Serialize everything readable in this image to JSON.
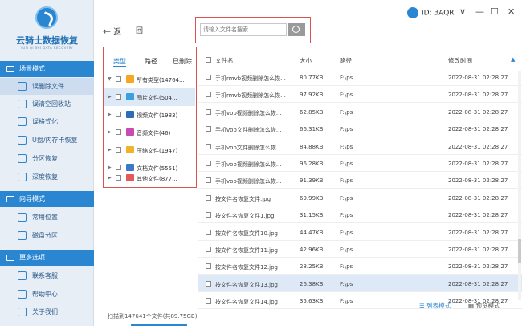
{
  "app": {
    "name": "云骑士数据恢复",
    "name_sub": "YUN QI SHI DATA RECOVERY",
    "user_label": "ID: 3AQR",
    "window_controls": [
      "∨",
      "—",
      "☐",
      "✕"
    ]
  },
  "sidebar": {
    "sections": [
      {
        "title": "场景模式",
        "items": [
          {
            "label": "误删除文件",
            "icon": "delete-file-icon",
            "active": true
          },
          {
            "label": "误清空回收站",
            "icon": "recycle-bin-icon"
          },
          {
            "label": "误格式化",
            "icon": "format-icon"
          },
          {
            "label": "U盘/内存卡恢复",
            "icon": "usb-icon"
          },
          {
            "label": "分区恢复",
            "icon": "partition-icon"
          },
          {
            "label": "深度恢复",
            "icon": "deep-scan-icon"
          }
        ]
      },
      {
        "title": "向导模式",
        "items": [
          {
            "label": "常用位置",
            "icon": "location-icon"
          },
          {
            "label": "磁盘分区",
            "icon": "disk-icon"
          }
        ]
      },
      {
        "title": "更多选项",
        "items": [
          {
            "label": "联系客服",
            "icon": "support-icon"
          },
          {
            "label": "帮助中心",
            "icon": "help-icon"
          },
          {
            "label": "关于我们",
            "icon": "info-icon"
          }
        ]
      }
    ]
  },
  "toolbar": {
    "back_label": "返",
    "back_arrow": "←",
    "home_label": "回",
    "search_placeholder": "请输入文件名搜索"
  },
  "tree": {
    "tabs": [
      "类型",
      "路径",
      "已删除"
    ],
    "rows": [
      {
        "label": "所有类型(14764...",
        "color": "#f5a623",
        "expand": "▼",
        "selected": false
      },
      {
        "label": "图片文件(504...",
        "color": "#3aa0e0",
        "expand": "▶",
        "selected": true
      },
      {
        "label": "视频文件(1983)",
        "color": "#2a6fb3",
        "expand": "▶",
        "selected": false
      },
      {
        "label": "音频文件(46)",
        "color": "#c84ab3",
        "expand": "▶",
        "selected": false
      },
      {
        "label": "压缩文件(1947)",
        "color": "#f0b429",
        "expand": "▶",
        "selected": false
      },
      {
        "label": "文档文件(5551)",
        "color": "#3a7ac8",
        "expand": "▶",
        "selected": false
      },
      {
        "label": "其他文件(877...",
        "color": "#e45a5a",
        "expand": "▶",
        "selected": false
      }
    ]
  },
  "files": {
    "columns": {
      "name": "文件名",
      "size": "大小",
      "path": "路径",
      "time": "修改时间"
    },
    "sort_indicator": "▲",
    "rows": [
      {
        "name": "手机rmvb视频删除怎么恢...",
        "size": "80.77KB",
        "path": "F:\\ps",
        "time": "2022-08-31 02:28:27"
      },
      {
        "name": "手机rmvb视频删除怎么恢...",
        "size": "97.92KB",
        "path": "F:\\ps",
        "time": "2022-08-31 02:28:27"
      },
      {
        "name": "手机vob视频删除怎么恢...",
        "size": "62.85KB",
        "path": "F:\\ps",
        "time": "2022-08-31 02:28:27"
      },
      {
        "name": "手机vob文件删除怎么恢...",
        "size": "66.31KB",
        "path": "F:\\ps",
        "time": "2022-08-31 02:28:27"
      },
      {
        "name": "手机vob文件删除怎么恢...",
        "size": "84.88KB",
        "path": "F:\\ps",
        "time": "2022-08-31 02:28:27"
      },
      {
        "name": "手机vob视频删除怎么恢...",
        "size": "96.28KB",
        "path": "F:\\ps",
        "time": "2022-08-31 02:28:27"
      },
      {
        "name": "手机vob视频删除怎么恢...",
        "size": "91.39KB",
        "path": "F:\\ps",
        "time": "2022-08-31 02:28:27"
      },
      {
        "name": "按文件名恢复文件.jpg",
        "size": "69.99KB",
        "path": "F:\\ps",
        "time": "2022-08-31 02:28:27"
      },
      {
        "name": "按文件名恢复文件1.jpg",
        "size": "31.15KB",
        "path": "F:\\ps",
        "time": "2022-08-31 02:28:27"
      },
      {
        "name": "按文件名恢复文件10.jpg",
        "size": "44.47KB",
        "path": "F:\\ps",
        "time": "2022-08-31 02:28:27"
      },
      {
        "name": "按文件名恢复文件11.jpg",
        "size": "42.96KB",
        "path": "F:\\ps",
        "time": "2022-08-31 02:28:27"
      },
      {
        "name": "按文件名恢复文件12.jpg",
        "size": "28.25KB",
        "path": "F:\\ps",
        "time": "2022-08-31 02:28:27"
      },
      {
        "name": "按文件名恢复文件13.jpg",
        "size": "26.38KB",
        "path": "F:\\ps",
        "time": "2022-08-31 02:28:27",
        "selected": true
      },
      {
        "name": "按文件名恢复文件14.jpg",
        "size": "35.63KB",
        "path": "F:\\ps",
        "time": "2022-08-31 02:28:27"
      }
    ]
  },
  "view_modes": {
    "list": "列表模式",
    "preview": "预览模式"
  },
  "status": {
    "scan_text": "扫描到147641个文件(共89.75GB)"
  }
}
